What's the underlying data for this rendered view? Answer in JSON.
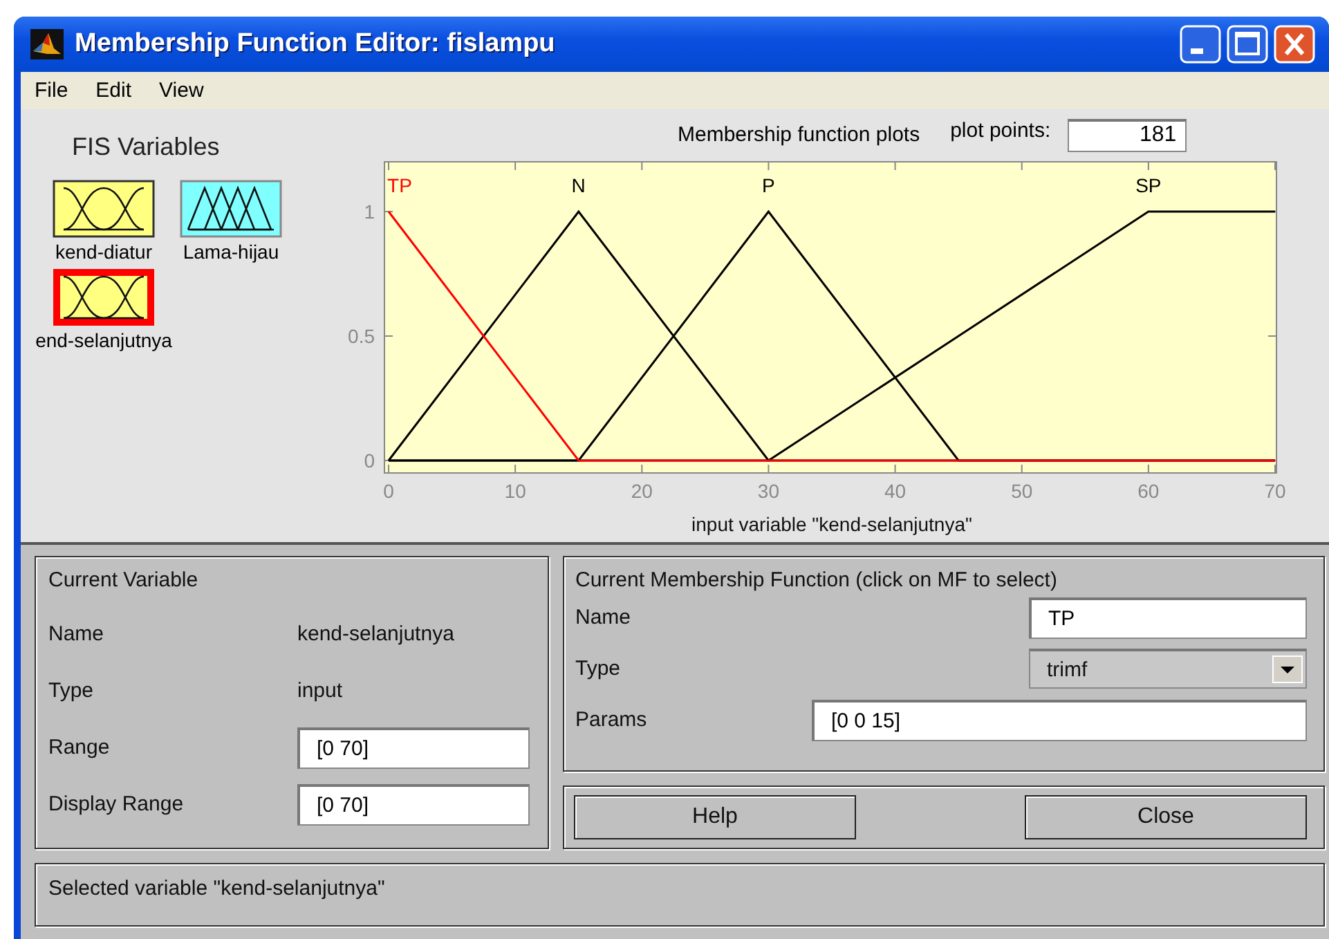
{
  "window": {
    "title": "Membership Function Editor: fislampu"
  },
  "menu": [
    "File",
    "Edit",
    "View"
  ],
  "fis_variables": {
    "title": "FIS Variables",
    "items": [
      {
        "label": "kend-diatur",
        "kind": "input",
        "selected": false
      },
      {
        "label": "Lama-hijau",
        "kind": "output",
        "selected": false
      },
      {
        "label": "end-selanjutnya",
        "kind": "input",
        "selected": true
      }
    ]
  },
  "plot": {
    "title": "Membership function plots",
    "plot_points_label": "plot points:",
    "plot_points": "181",
    "chart_data": {
      "type": "line",
      "xlabel": "input variable \"kend-selanjutnya\"",
      "x": [
        0,
        15,
        30,
        45,
        60,
        70
      ],
      "xlim": [
        0,
        70
      ],
      "ylim": [
        -0.05,
        1.2
      ],
      "xticks": [
        0,
        10,
        20,
        30,
        40,
        50,
        60,
        70
      ],
      "yticks": [
        0,
        0.5,
        1
      ],
      "series": [
        {
          "name": "TP",
          "color": "#ff0000",
          "values": [
            1,
            0,
            0,
            0,
            0,
            0
          ]
        },
        {
          "name": "N",
          "color": "#000000",
          "values": [
            0,
            1,
            0,
            0,
            0,
            0
          ]
        },
        {
          "name": "P",
          "color": "#000000",
          "values": [
            0,
            0,
            1,
            0,
            0,
            0
          ]
        },
        {
          "name": "SP",
          "color": "#000000",
          "values": [
            0,
            0,
            0,
            0.5,
            1,
            1
          ]
        }
      ]
    }
  },
  "current_variable": {
    "title": "Current Variable",
    "name_label": "Name",
    "name": "kend-selanjutnya",
    "type_label": "Type",
    "type": "input",
    "range_label": "Range",
    "range": "[0 70]",
    "display_range_label": "Display Range",
    "display_range": "[0 70]"
  },
  "current_mf": {
    "title": "Current Membership Function (click on MF to select)",
    "name_label": "Name",
    "name": "TP",
    "type_label": "Type",
    "type": "trimf",
    "params_label": "Params",
    "params": "[0 0 15]"
  },
  "buttons": [
    "Help",
    "Close"
  ],
  "status": "Selected variable \"kend-selanjutnya\""
}
